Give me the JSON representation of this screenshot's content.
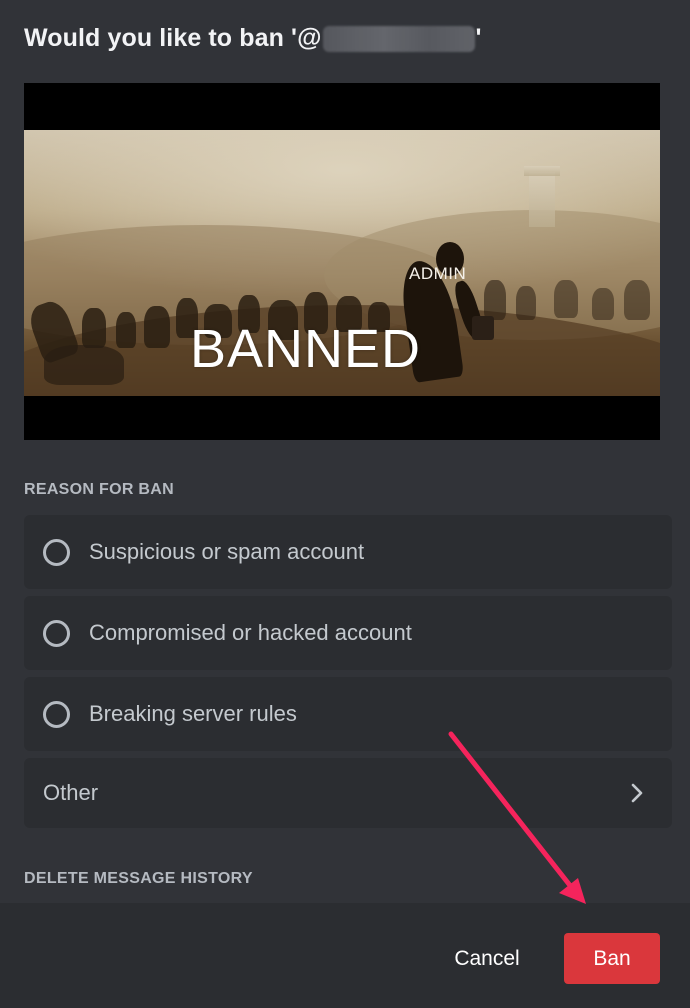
{
  "dialog": {
    "title_prefix": "Would you like to ban '@",
    "title_suffix": "'"
  },
  "gif": {
    "caption_small": "ADMIN",
    "caption_large": "BANNED"
  },
  "reason_section": {
    "label": "REASON FOR BAN",
    "options": [
      {
        "label": "Suspicious or spam account"
      },
      {
        "label": "Compromised or hacked account"
      },
      {
        "label": "Breaking server rules"
      }
    ],
    "other_label": "Other"
  },
  "delete_history_section": {
    "label": "DELETE MESSAGE HISTORY"
  },
  "footer": {
    "cancel_label": "Cancel",
    "ban_label": "Ban"
  },
  "colors": {
    "background": "#313338",
    "option_background": "#2b2d31",
    "danger": "#da373c",
    "annotation_arrow": "#f5245c"
  }
}
